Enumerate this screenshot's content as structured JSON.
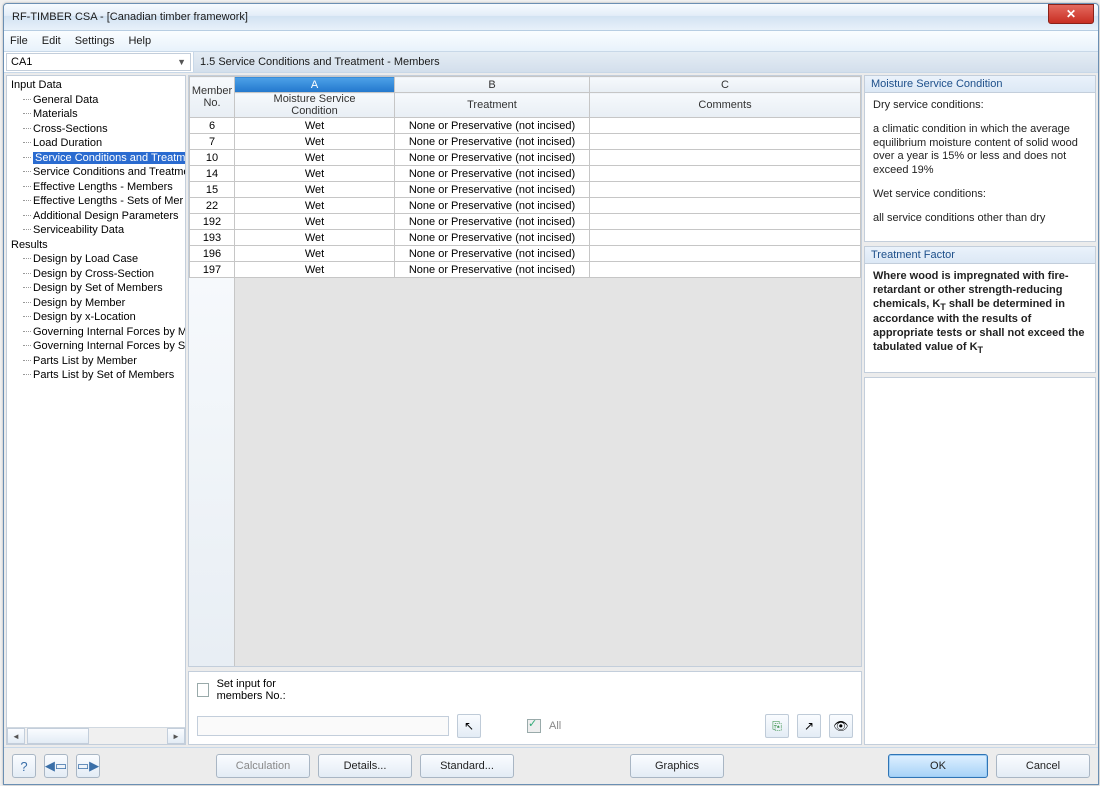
{
  "window": {
    "title": "RF-TIMBER CSA - [Canadian timber framework]"
  },
  "menu": {
    "file": "File",
    "edit": "Edit",
    "settings": "Settings",
    "help": "Help"
  },
  "combo": {
    "value": "CA1"
  },
  "panel_title": "1.5 Service Conditions and Treatment - Members",
  "tree": {
    "input_data": "Input Data",
    "general_data": "General Data",
    "materials": "Materials",
    "cross_sections": "Cross-Sections",
    "load_duration": "Load Duration",
    "svc_cond_a": "Service Conditions and Treatme",
    "svc_cond_b": "Service Conditions and Treatme",
    "eff_len_members": "Effective Lengths - Members",
    "eff_len_sets": "Effective Lengths - Sets of Mer",
    "add_design_params": "Additional Design Parameters",
    "serviceability": "Serviceability Data",
    "results": "Results",
    "d_loadcase": "Design by Load Case",
    "d_crosssection": "Design by Cross-Section",
    "d_setmembers": "Design by Set of Members",
    "d_member": "Design by Member",
    "d_xloc": "Design by x-Location",
    "gov_m": "Governing Internal Forces by M",
    "gov_s": "Governing Internal Forces by S",
    "parts_member": "Parts List by Member",
    "parts_set": "Parts List by Set of Members"
  },
  "grid": {
    "head_member_no": "Member\nNo.",
    "head_member_no_top": "Member",
    "head_member_no_bot": "No.",
    "col_A": "A",
    "col_B": "B",
    "col_C": "C",
    "head_moisture_top": "Moisture Service",
    "head_moisture_bot": "Condition",
    "head_treatment": "Treatment",
    "head_comments": "Comments",
    "rows": [
      {
        "no": "6",
        "a": "Wet",
        "b": "None or Preservative (not incised)",
        "c": ""
      },
      {
        "no": "7",
        "a": "Wet",
        "b": "None or Preservative (not incised)",
        "c": ""
      },
      {
        "no": "10",
        "a": "Wet",
        "b": "None or Preservative (not incised)",
        "c": ""
      },
      {
        "no": "14",
        "a": "Wet",
        "b": "None or Preservative (not incised)",
        "c": ""
      },
      {
        "no": "15",
        "a": "Wet",
        "b": "None or Preservative (not incised)",
        "c": ""
      },
      {
        "no": "22",
        "a": "Wet",
        "b": "None or Preservative (not incised)",
        "c": ""
      },
      {
        "no": "192",
        "a": "Wet",
        "b": "None or Preservative (not incised)",
        "c": ""
      },
      {
        "no": "193",
        "a": "Wet",
        "b": "None or Preservative (not incised)",
        "c": ""
      },
      {
        "no": "196",
        "a": "Wet",
        "b": "None or Preservative (not incised)",
        "c": ""
      },
      {
        "no": "197",
        "a": "Wet",
        "b": "None or Preservative (not incised)",
        "c": ""
      }
    ]
  },
  "lower": {
    "set_input": "Set input for members No.:",
    "all": "All"
  },
  "moisture_box": {
    "title": "Moisture Service Condition",
    "dry_h": "Dry service conditions:",
    "dry_b": "a climatic condition in which the average equilibrium moisture content of solid wood over a year is 15% or less and does not exceed 19%",
    "wet_h": "Wet service conditions:",
    "wet_b": "all service conditions other than dry"
  },
  "treatment_box": {
    "title": "Treatment Factor",
    "body": "Where wood is impregnated with fire-retardant or other strength-reducing chemicals, KT shall be determined in accordance with the results of appropriate tests or shall not exceed the tabulated value of KT"
  },
  "footer": {
    "calculation": "Calculation",
    "details": "Details...",
    "standard": "Standard...",
    "graphics": "Graphics",
    "ok": "OK",
    "cancel": "Cancel"
  }
}
